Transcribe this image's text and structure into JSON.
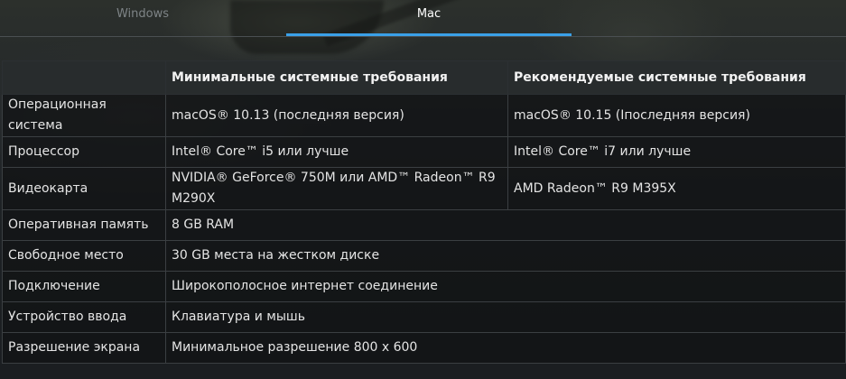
{
  "tabs": {
    "windows_label": "Windows",
    "mac_label": "Mac",
    "active": "Mac"
  },
  "table": {
    "headers": {
      "param": "",
      "minimum": "Минимальные системные требования",
      "recommended": "Рекомендуемые системные требования"
    },
    "rows": [
      {
        "param": "Операционная система",
        "minimum": "macOS® 10.13 (последняя версия)",
        "recommended": "macOS® 10.15 (Iпоследняя версия)"
      },
      {
        "param": "Процессор",
        "minimum": "Intel® Core™ i5 или лучше",
        "recommended": "Intel® Core™ i7 или лучше"
      },
      {
        "param": "Видеокарта",
        "minimum": "NVIDIA® GeForce® 750M или AMD™ Radeon™ R9 M290X",
        "recommended": "AMD Radeon™ R9 M395X"
      },
      {
        "param": "Оперативная память",
        "value": "8 GB RAM"
      },
      {
        "param": "Свободное место",
        "value": "30 GB места на жестком диске"
      },
      {
        "param": "Подключение",
        "value": "Широкополосное интернет соединение"
      },
      {
        "param": "Устройство ввода",
        "value": "Клавиатура и мышь"
      },
      {
        "param": "Разрешение экрана",
        "value": "Минимальное разрешение 800 x 600"
      }
    ]
  }
}
